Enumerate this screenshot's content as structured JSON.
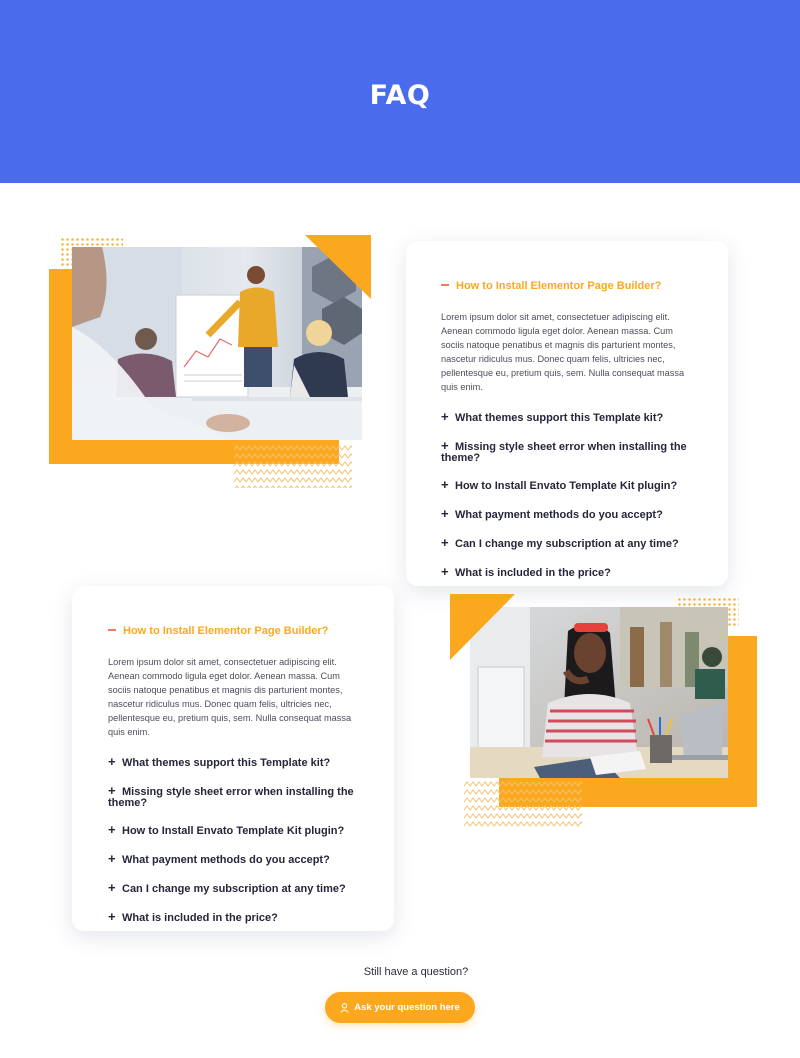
{
  "hero": {
    "title": "FAQ"
  },
  "faq_blocks": [
    {
      "open_question": "How to Install Elementor Page Builder?",
      "answer": "Lorem ipsum dolor sit amet, consectetuer adipiscing elit. Aenean commodo ligula eget dolor. Aenean massa. Cum sociis natoque penatibus et magnis dis parturient montes, nascetur ridiculus mus. Donec quam felis, ultricies nec, pellentesque eu, pretium quis, sem. Nulla consequat massa quis enim.",
      "questions": [
        "What themes support this Template kit?",
        "Missing style sheet error when installing the theme?",
        "How to Install Envato Template Kit plugin?",
        "What payment methods do you accept?",
        "Can I change my subscription at any time?",
        "What is included in the price?"
      ]
    },
    {
      "open_question": "How to Install Elementor Page Builder?",
      "answer": "Lorem ipsum dolor sit amet, consectetuer adipiscing elit. Aenean commodo ligula eget dolor. Aenean massa. Cum sociis natoque penatibus et magnis dis parturient montes, nascetur ridiculus mus. Donec quam felis, ultricies nec, pellentesque eu, pretium quis, sem. Nulla consequat massa quis enim.",
      "questions": [
        "What themes support this Template kit?",
        "Missing style sheet error when installing the theme?",
        "How to Install Envato Template Kit plugin?",
        "What payment methods do you accept?",
        "Can I change my subscription at any time?",
        "What is included in the price?"
      ]
    }
  ],
  "footer_cta": {
    "prompt": "Still have a question?",
    "button_label": "Ask your question here",
    "button_icon": "user-icon"
  },
  "colors": {
    "hero_blue": "#4a6cec",
    "accent_orange": "#fca81f",
    "minus_red": "#f27a62"
  }
}
